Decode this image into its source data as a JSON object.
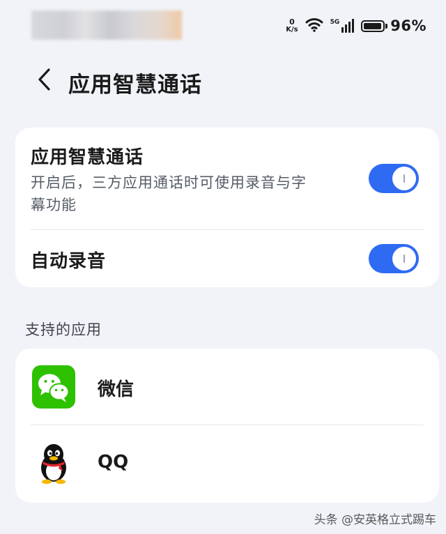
{
  "status_bar": {
    "net_speed_value": "0",
    "net_speed_unit": "K/s",
    "signal_type": "5G",
    "battery_percent": "96%",
    "battery_level": 0.96
  },
  "header": {
    "title": "应用智慧通话"
  },
  "settings": {
    "smart_call": {
      "title": "应用智慧通话",
      "description_line1": "开启后，三方应用通话时可使用录音与字",
      "description_line2": "幕功能",
      "enabled": true
    },
    "auto_record": {
      "title": "自动录音",
      "enabled": true
    }
  },
  "supported_apps": {
    "section_label": "支持的应用",
    "apps": [
      {
        "name": "微信",
        "icon": "wechat-icon"
      },
      {
        "name": "QQ",
        "icon": "qq-penguin-icon"
      }
    ]
  },
  "watermark": "头条 @安英格立式踢车",
  "colors": {
    "accent": "#2f6bf2",
    "background": "#f1f3f8",
    "card": "#ffffff",
    "wechat_green": "#2dc100"
  }
}
